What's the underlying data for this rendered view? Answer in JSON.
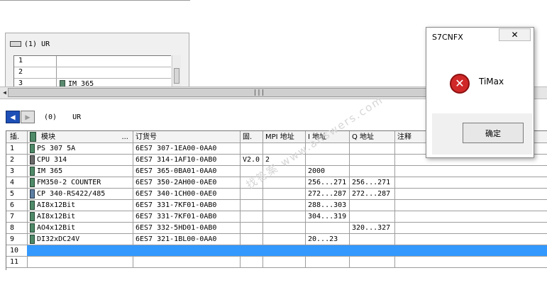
{
  "upper_rack": {
    "title": "(1)  UR",
    "rows": [
      {
        "slot": "1",
        "module": ""
      },
      {
        "slot": "2",
        "module": ""
      },
      {
        "slot": "3",
        "module": "IM 365"
      }
    ]
  },
  "lower_rack": {
    "rack_id": "(0)",
    "rack_name": "UR",
    "columns": {
      "slot": "插.",
      "module": "模块",
      "module_more": "...",
      "order_no": "订货号",
      "firmware": "固.",
      "mpi": "MPI 地址",
      "i_addr": "I 地址",
      "q_addr": "Q 地址",
      "comment": "注释"
    },
    "rows": [
      {
        "slot": "1",
        "icon": "module-icon",
        "module": "PS 307 5A",
        "order": "6ES7 307-1EA00-0AA0",
        "fw": "",
        "mpi": "",
        "i": "",
        "q": ""
      },
      {
        "slot": "2",
        "icon": "cpu-icon",
        "module": "CPU 314",
        "order": "6ES7 314-1AF10-0AB0",
        "fw": "V2.0",
        "mpi": "2",
        "i": "",
        "q": ""
      },
      {
        "slot": "3",
        "icon": "module-icon",
        "module": "IM 365",
        "order": "6ES7 365-0BA01-0AA0",
        "fw": "",
        "mpi": "",
        "i": "2000",
        "q": ""
      },
      {
        "slot": "4",
        "icon": "module-icon",
        "module": "FM350-2 COUNTER",
        "order": "6ES7 350-2AH00-0AE0",
        "fw": "",
        "mpi": "",
        "i": "256...271",
        "q": "256...271"
      },
      {
        "slot": "5",
        "icon": "cp-icon",
        "module": "CP 340-RS422/485",
        "order": "6ES7 340-1CH00-0AE0",
        "fw": "",
        "mpi": "",
        "i": "272...287",
        "q": "272...287"
      },
      {
        "slot": "6",
        "icon": "module-icon",
        "module": "AI8x12Bit",
        "order": "6ES7 331-7KF01-0AB0",
        "fw": "",
        "mpi": "",
        "i": "288...303",
        "q": ""
      },
      {
        "slot": "7",
        "icon": "module-icon",
        "module": "AI8x12Bit",
        "order": "6ES7 331-7KF01-0AB0",
        "fw": "",
        "mpi": "",
        "i": "304...319",
        "q": ""
      },
      {
        "slot": "8",
        "icon": "module-icon",
        "module": "AO4x12Bit",
        "order": "6ES7 332-5HD01-0AB0",
        "fw": "",
        "mpi": "",
        "i": "",
        "q": "320...327"
      },
      {
        "slot": "9",
        "icon": "module-icon",
        "module": "DI32xDC24V",
        "order": "6ES7 321-1BL00-0AA0",
        "fw": "",
        "mpi": "",
        "i": "20...23",
        "q": ""
      },
      {
        "slot": "10",
        "icon": "",
        "module": "",
        "order": "",
        "fw": "",
        "mpi": "",
        "i": "",
        "q": "",
        "selected": true
      },
      {
        "slot": "11",
        "icon": "",
        "module": "",
        "order": "",
        "fw": "",
        "mpi": "",
        "i": "",
        "q": ""
      }
    ]
  },
  "dialog": {
    "title": "S7CNFX",
    "close_label": "✕",
    "message": "TiMax",
    "ok_label": "确定",
    "icon": "error-icon"
  },
  "scrollbar": {
    "grip": "|||"
  },
  "watermark": "找答案 www.answers.com"
}
